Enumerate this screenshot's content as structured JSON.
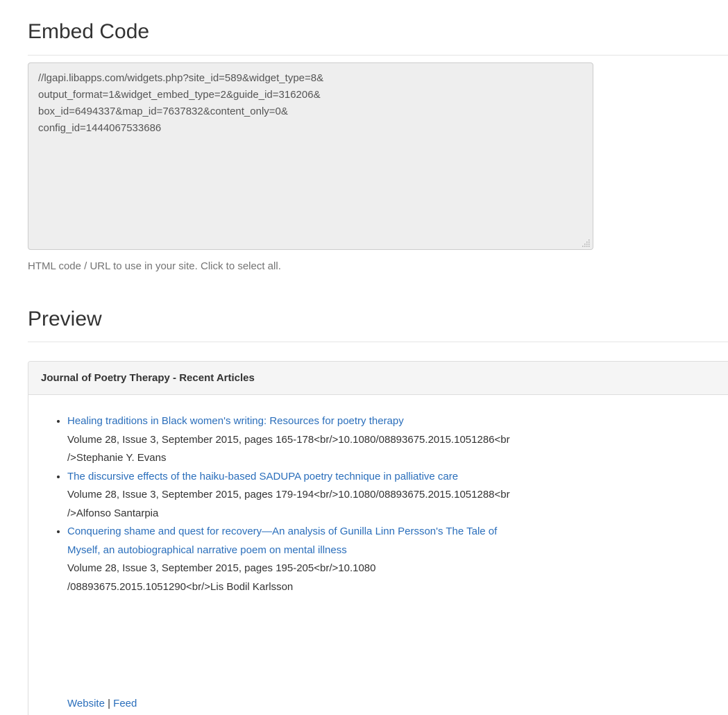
{
  "embed_section": {
    "heading": "Embed Code",
    "code_lines": [
      "//lgapi.libapps.com/widgets.php?site_id=589&widget_type=8&",
      "output_format=1&widget_embed_type=2&guide_id=316206&",
      "box_id=6494337&map_id=7637832&content_only=0&",
      "config_id=1444067533686"
    ],
    "help_text": "HTML code / URL to use in your site. Click to select all."
  },
  "preview_section": {
    "heading": "Preview",
    "panel_title": "Journal of Poetry Therapy - Recent Articles",
    "articles": [
      {
        "title": "Healing traditions in Black women's writing: Resources for poetry therapy",
        "meta_line_1": "Volume 28, Issue 3, September 2015, pages 165-178<br/>10.1080/08893675.2015.1051286<br",
        "meta_line_2": "/>Stephanie Y. Evans"
      },
      {
        "title": "The discursive effects of the haiku-based SADUPA poetry technique in palliative care",
        "meta_line_1": "Volume 28, Issue 3, September 2015, pages 179-194<br/>10.1080/08893675.2015.1051288<br",
        "meta_line_2": "/>Alfonso Santarpia"
      },
      {
        "title_line_1": "Conquering shame and quest for recovery—An analysis of Gunilla Linn Persson's The Tale of",
        "title_line_2": "Myself, an autobiographical narrative poem on mental illness",
        "meta_line_1": "Volume 28, Issue 3, September 2015, pages 195-205<br/>10.1080",
        "meta_line_2": "/08893675.2015.1051290<br/>Lis Bodil Karlsson"
      }
    ],
    "footer": {
      "website_label": "Website",
      "separator": "|",
      "feed_label": "Feed"
    }
  }
}
